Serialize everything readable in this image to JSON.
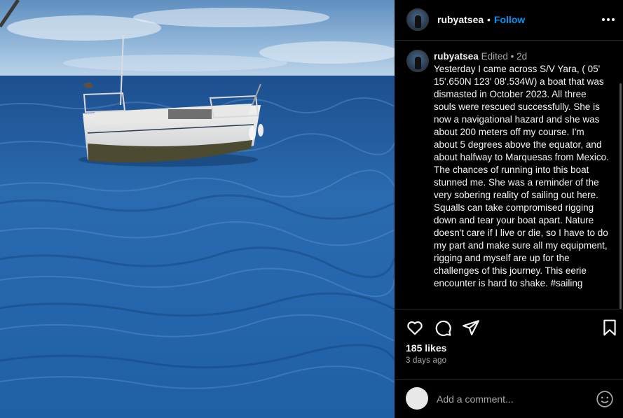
{
  "post": {
    "username": "rubyatsea",
    "follow_separator": "•",
    "follow_label": "Follow"
  },
  "caption": {
    "username": "rubyatsea",
    "edited_label": "Edited",
    "separator": "•",
    "time": "2d",
    "text": "Yesterday I came across S/V Yara, ( 05' 15'.650N 123' 08'.534W) a boat that was dismasted in October 2023. All three souls were rescued successfully. She is now a navigational hazard and she was about 200 meters off my course. I'm about 5 degrees above the equator, and about halfway to Marquesas from Mexico. The chances of running into this boat stunned me. She was a reminder of the very sobering reality of sailing out here. Squalls can take compromised rigging down and tear your boat apart. Nature doesn't care if I live or die, so I have to do my part and make sure all my equipment, rigging and myself are up for the challenges of this journey. This eerie encounter is hard to shake. #sailing"
  },
  "actions": {
    "icons": [
      "heart-icon",
      "comment-icon",
      "share-icon",
      "bookmark-icon",
      "more-icon",
      "emoji-icon"
    ],
    "likes": "185 likes",
    "date": "3 days ago"
  },
  "comment": {
    "placeholder": "Add a comment..."
  },
  "colors": {
    "background": "#000000",
    "text": "#f5f5f5",
    "secondary_text": "#a8a8a8",
    "follow_blue": "#0095f6",
    "divider": "#262626"
  }
}
